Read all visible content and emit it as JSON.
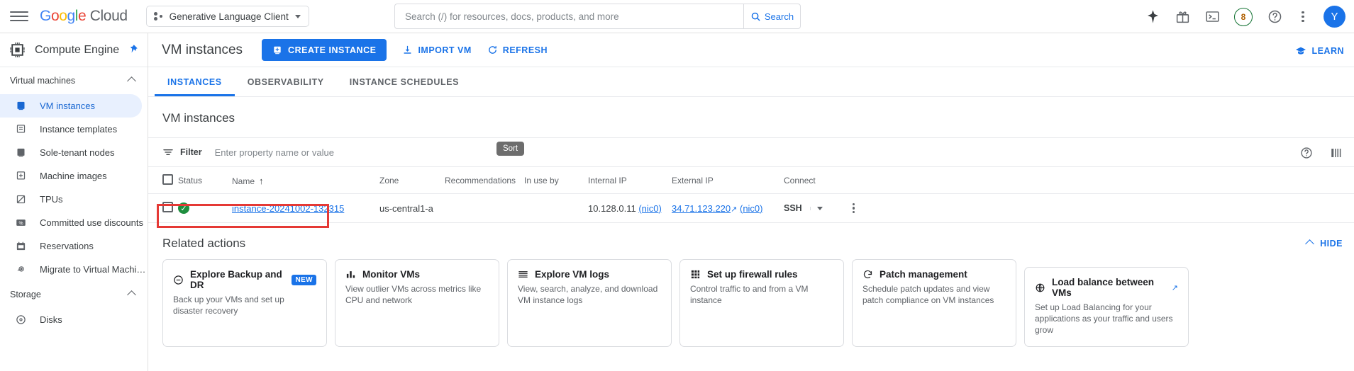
{
  "topbar": {
    "menu_icon": "hamburger-menu-icon",
    "logo": {
      "google": "Google",
      "cloud": "Cloud"
    },
    "project": {
      "name": "Generative Language Client",
      "icon": "project-dots-icon"
    },
    "search": {
      "placeholder": "Search (/) for resources, docs, products, and more",
      "value": "",
      "button_label": "Search",
      "icon": "search-icon"
    },
    "icons": {
      "gemini": "sparkle-icon",
      "gifts": "gift-icon",
      "cloud_shell": "terminal-icon",
      "help": "help-circle-icon",
      "more": "kebab-menu-icon"
    },
    "credits_badge": "8",
    "avatar_initial": "Y"
  },
  "sidebar": {
    "product_title": "Compute Engine",
    "product_icon": "cpu-chip-icon",
    "pin_icon": "pin-icon",
    "sections": [
      {
        "label": "Virtual machines",
        "expanded": true,
        "items": [
          {
            "label": "VM instances",
            "icon": "vm-instance-icon",
            "active": true
          },
          {
            "label": "Instance templates",
            "icon": "instance-template-icon",
            "active": false
          },
          {
            "label": "Sole-tenant nodes",
            "icon": "sole-tenant-icon",
            "active": false
          },
          {
            "label": "Machine images",
            "icon": "machine-image-icon",
            "active": false
          },
          {
            "label": "TPUs",
            "icon": "tpu-icon",
            "active": false
          },
          {
            "label": "Committed use discounts",
            "icon": "percent-icon",
            "active": false
          },
          {
            "label": "Reservations",
            "icon": "calendar-icon",
            "active": false
          },
          {
            "label": "Migrate to Virtual Machin…",
            "icon": "migrate-icon",
            "active": false
          }
        ]
      },
      {
        "label": "Storage",
        "expanded": true,
        "items": [
          {
            "label": "Disks",
            "icon": "disk-icon",
            "active": false
          }
        ]
      }
    ]
  },
  "main": {
    "page_title": "VM instances",
    "actions": {
      "create_instance": "CREATE INSTANCE",
      "import_vm": "IMPORT VM",
      "refresh": "REFRESH",
      "learn": "LEARN"
    },
    "tabs": [
      {
        "label": "INSTANCES",
        "active": true
      },
      {
        "label": "OBSERVABILITY",
        "active": false
      },
      {
        "label": "INSTANCE SCHEDULES",
        "active": false
      }
    ],
    "section_title": "VM instances",
    "filter": {
      "label": "Filter",
      "placeholder": "Enter property name or value",
      "value": "",
      "icon": "filter-icon",
      "tooltip": "Sort",
      "help_icon": "help-circle-icon",
      "columns_icon": "column-display-icon"
    },
    "table": {
      "columns": [
        "Status",
        "Name",
        "Zone",
        "Recommendations",
        "In use by",
        "Internal IP",
        "External IP",
        "Connect"
      ],
      "sorted_column": "Name",
      "sort_direction": "↑",
      "rows": [
        {
          "selected": false,
          "status": "running",
          "name": "instance-20241002-132315",
          "zone": "us-central1-a",
          "recommendations": "",
          "in_use_by": "",
          "internal_ip": "10.128.0.11",
          "internal_nic": "(nic0)",
          "external_ip": "34.71.123.220",
          "external_nic": "(nic0)",
          "connect_label": "SSH"
        }
      ]
    },
    "related_actions": {
      "title": "Related actions",
      "hide_label": "HIDE",
      "cards": [
        {
          "title": "Explore Backup and DR",
          "badge": "NEW",
          "desc": "Back up your VMs and set up disaster recovery",
          "icon": "backup-dr-icon",
          "external": false
        },
        {
          "title": "Monitor VMs",
          "badge": "",
          "desc": "View outlier VMs across metrics like CPU and network",
          "icon": "bar-chart-icon",
          "external": false
        },
        {
          "title": "Explore VM logs",
          "badge": "",
          "desc": "View, search, analyze, and download VM instance logs",
          "icon": "logs-icon",
          "external": false
        },
        {
          "title": "Set up firewall rules",
          "badge": "",
          "desc": "Control traffic to and from a VM instance",
          "icon": "firewall-icon",
          "external": false
        },
        {
          "title": "Patch management",
          "badge": "",
          "desc": "Schedule patch updates and view patch compliance on VM instances",
          "icon": "patch-icon",
          "external": false
        },
        {
          "title": "Load balance between VMs",
          "badge": "",
          "desc": "Set up Load Balancing for your applications as your traffic and users grow",
          "icon": "load-balance-icon",
          "external": true
        }
      ]
    }
  },
  "colors": {
    "accent_blue": "#1a73e8",
    "status_green": "#1e8e3e",
    "annotation_red": "#e53935",
    "active_nav_bg": "#e8f0fe"
  }
}
